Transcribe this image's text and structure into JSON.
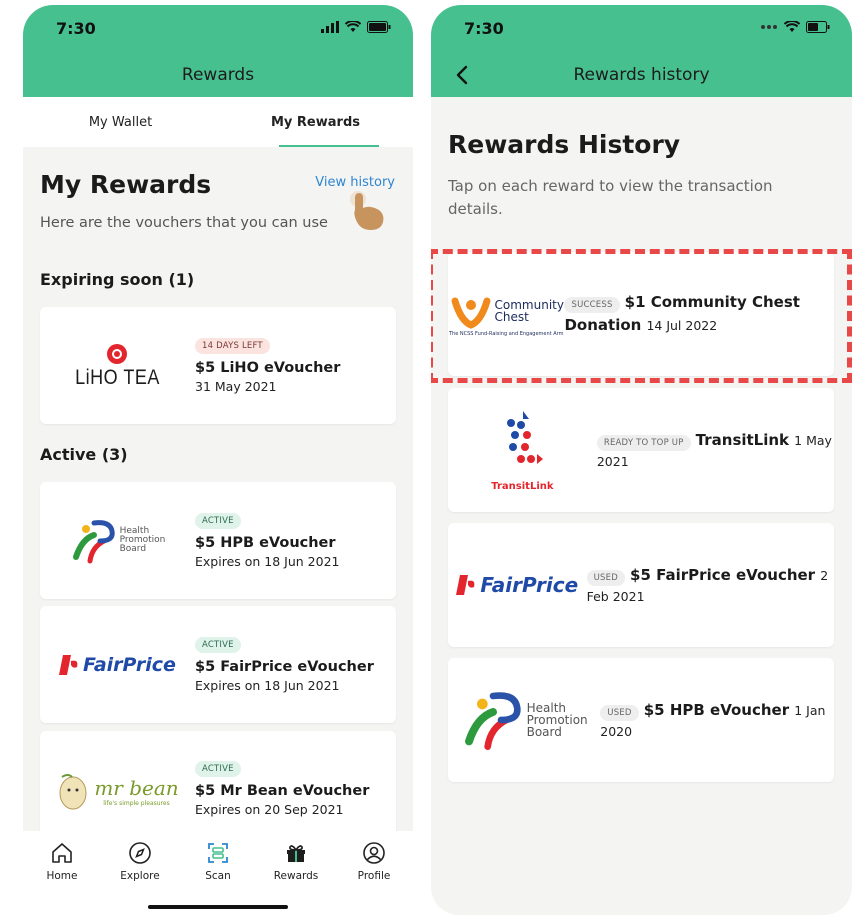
{
  "left_screen": {
    "status_time": "7:30",
    "nav_title": "Rewards",
    "tabs": [
      {
        "label": "My Wallet",
        "active": false
      },
      {
        "label": "My Rewards",
        "active": true
      }
    ],
    "heading": "My Rewards",
    "view_history_label": "View history",
    "subtext": "Here are the vouchers that you can use",
    "expiring_label": "Expiring soon (1)",
    "expiring": [
      {
        "logo": "LiHO TEA",
        "badge": "14 DAYS LEFT",
        "title": "$5 LiHO eVoucher",
        "date": "31 May 2021"
      }
    ],
    "active_label": "Active (3)",
    "active": [
      {
        "logo_line1": "Health",
        "logo_line2": "Promotion",
        "logo_line3": "Board",
        "badge": "ACTIVE",
        "title": "$5 HPB eVoucher",
        "date": "Expires on 18 Jun 2021"
      },
      {
        "logo": "FairPrice",
        "badge": "ACTIVE",
        "title": "$5 FairPrice eVoucher",
        "date": "Expires on 18 Jun 2021"
      },
      {
        "logo": "mr bean",
        "logo_tag": "life's simple pleasures",
        "badge": "ACTIVE",
        "title": "$5 Mr Bean eVoucher",
        "date": "Expires on 20 Sep 2021"
      }
    ],
    "bottom_nav": [
      {
        "label": "Home",
        "icon": "home-icon"
      },
      {
        "label": "Explore",
        "icon": "compass-icon"
      },
      {
        "label": "Scan",
        "icon": "scan-icon"
      },
      {
        "label": "Rewards",
        "icon": "gift-icon"
      },
      {
        "label": "Profile",
        "icon": "profile-icon"
      }
    ]
  },
  "right_screen": {
    "status_time": "7:30",
    "nav_title": "Rewards history",
    "heading": "Rewards History",
    "subtext": "Tap on each reward to view the transaction details.",
    "history": [
      {
        "logo_line1": "Community",
        "logo_line2": "Chest",
        "logo_tag": "The NCSS Fund-Raising and Engagement Arm",
        "badge": "SUCCESS",
        "title": "$1 Community Chest Donation",
        "date": "14 Jul 2022"
      },
      {
        "logo": "TransitLink",
        "badge": "READY TO TOP UP",
        "title": "TransitLink",
        "date": "1 May 2021"
      },
      {
        "logo": "FairPrice",
        "badge": "USED",
        "title": "$5 FairPrice eVoucher",
        "date": "2 Feb 2021"
      },
      {
        "logo_line1": "Health",
        "logo_line2": "Promotion",
        "logo_line3": "Board",
        "badge": "USED",
        "title": "$5 HPB eVoucher",
        "date": "1 Jan 2020"
      }
    ]
  },
  "colors": {
    "brand_green": "#47c08f",
    "link_blue": "#2e86d1",
    "highlight_red": "#e84848"
  }
}
